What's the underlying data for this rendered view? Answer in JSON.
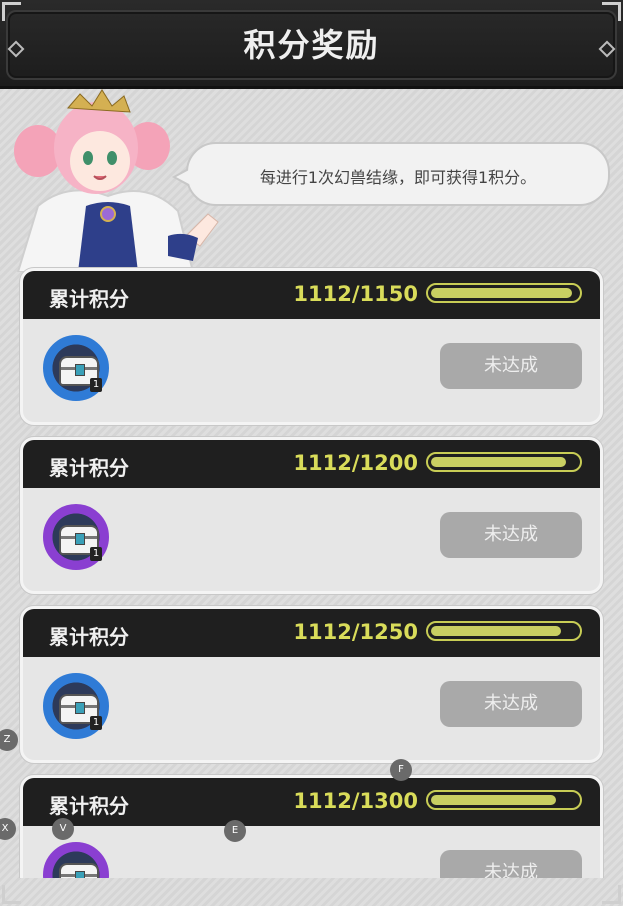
{
  "header": {
    "title": "积分奖励"
  },
  "bubble": {
    "text": "每进行1次幻兽结缘，即可获得1积分。"
  },
  "rewards": [
    {
      "label": "累计积分",
      "score": "1112/1150",
      "progress": 0.967,
      "status": "未达成",
      "ring_color": "#2f7bd6",
      "item_count": "1"
    },
    {
      "label": "累计积分",
      "score": "1112/1200",
      "progress": 0.927,
      "status": "未达成",
      "ring_color": "#8a3fd1",
      "item_count": "1"
    },
    {
      "label": "累计积分",
      "score": "1112/1250",
      "progress": 0.89,
      "status": "未达成",
      "ring_color": "#2f7bd6",
      "item_count": "1"
    },
    {
      "label": "累计积分",
      "score": "1112/1300",
      "progress": 0.855,
      "status": "未达成",
      "ring_color": "#8a3fd1",
      "item_count": "1"
    }
  ],
  "key_hints": [
    "Z",
    "F",
    "X",
    "V",
    "E"
  ],
  "colors": {
    "accent": "#d9dc5a",
    "bar_fill": "#c9cf62",
    "header_bg": "#1f1f1f",
    "button_disabled": "#a9a9a9"
  }
}
